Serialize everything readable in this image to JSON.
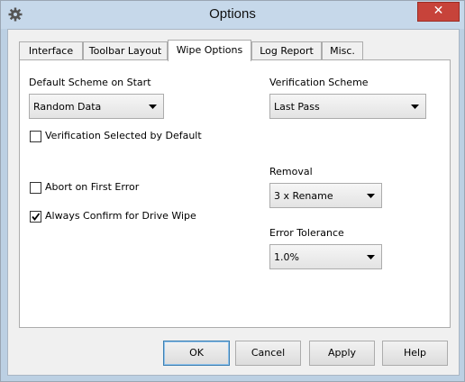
{
  "window": {
    "title": "Options"
  },
  "tabs": [
    {
      "label": "Interface",
      "active": false
    },
    {
      "label": "Toolbar Layout",
      "active": false
    },
    {
      "label": "Wipe Options",
      "active": true
    },
    {
      "label": "Log Report",
      "active": false
    },
    {
      "label": "Misc.",
      "active": false
    }
  ],
  "wipe": {
    "default_scheme_label": "Default Scheme on Start",
    "default_scheme_value": "Random Data",
    "verification_selected_label": "Verification Selected by Default",
    "verification_selected_checked": false,
    "abort_first_error_label": "Abort on First Error",
    "abort_first_error_checked": false,
    "always_confirm_label": "Always Confirm for Drive Wipe",
    "always_confirm_checked": true,
    "verification_scheme_label": "Verification Scheme",
    "verification_scheme_value": "Last Pass",
    "removal_label": "Removal",
    "removal_value": "3 x Rename",
    "error_tolerance_label": "Error Tolerance",
    "error_tolerance_value": "1.0%"
  },
  "buttons": {
    "ok": "OK",
    "cancel": "Cancel",
    "apply": "Apply",
    "help": "Help"
  },
  "icons": {
    "app": "gear-icon",
    "close": "close-icon",
    "dropdown": "dropdown-arrow-icon",
    "check": "checkmark-icon"
  },
  "colors": {
    "close_button": "#c7433a",
    "titlebar": "#c6d8ea",
    "default_button_border": "#3c7fb1"
  }
}
